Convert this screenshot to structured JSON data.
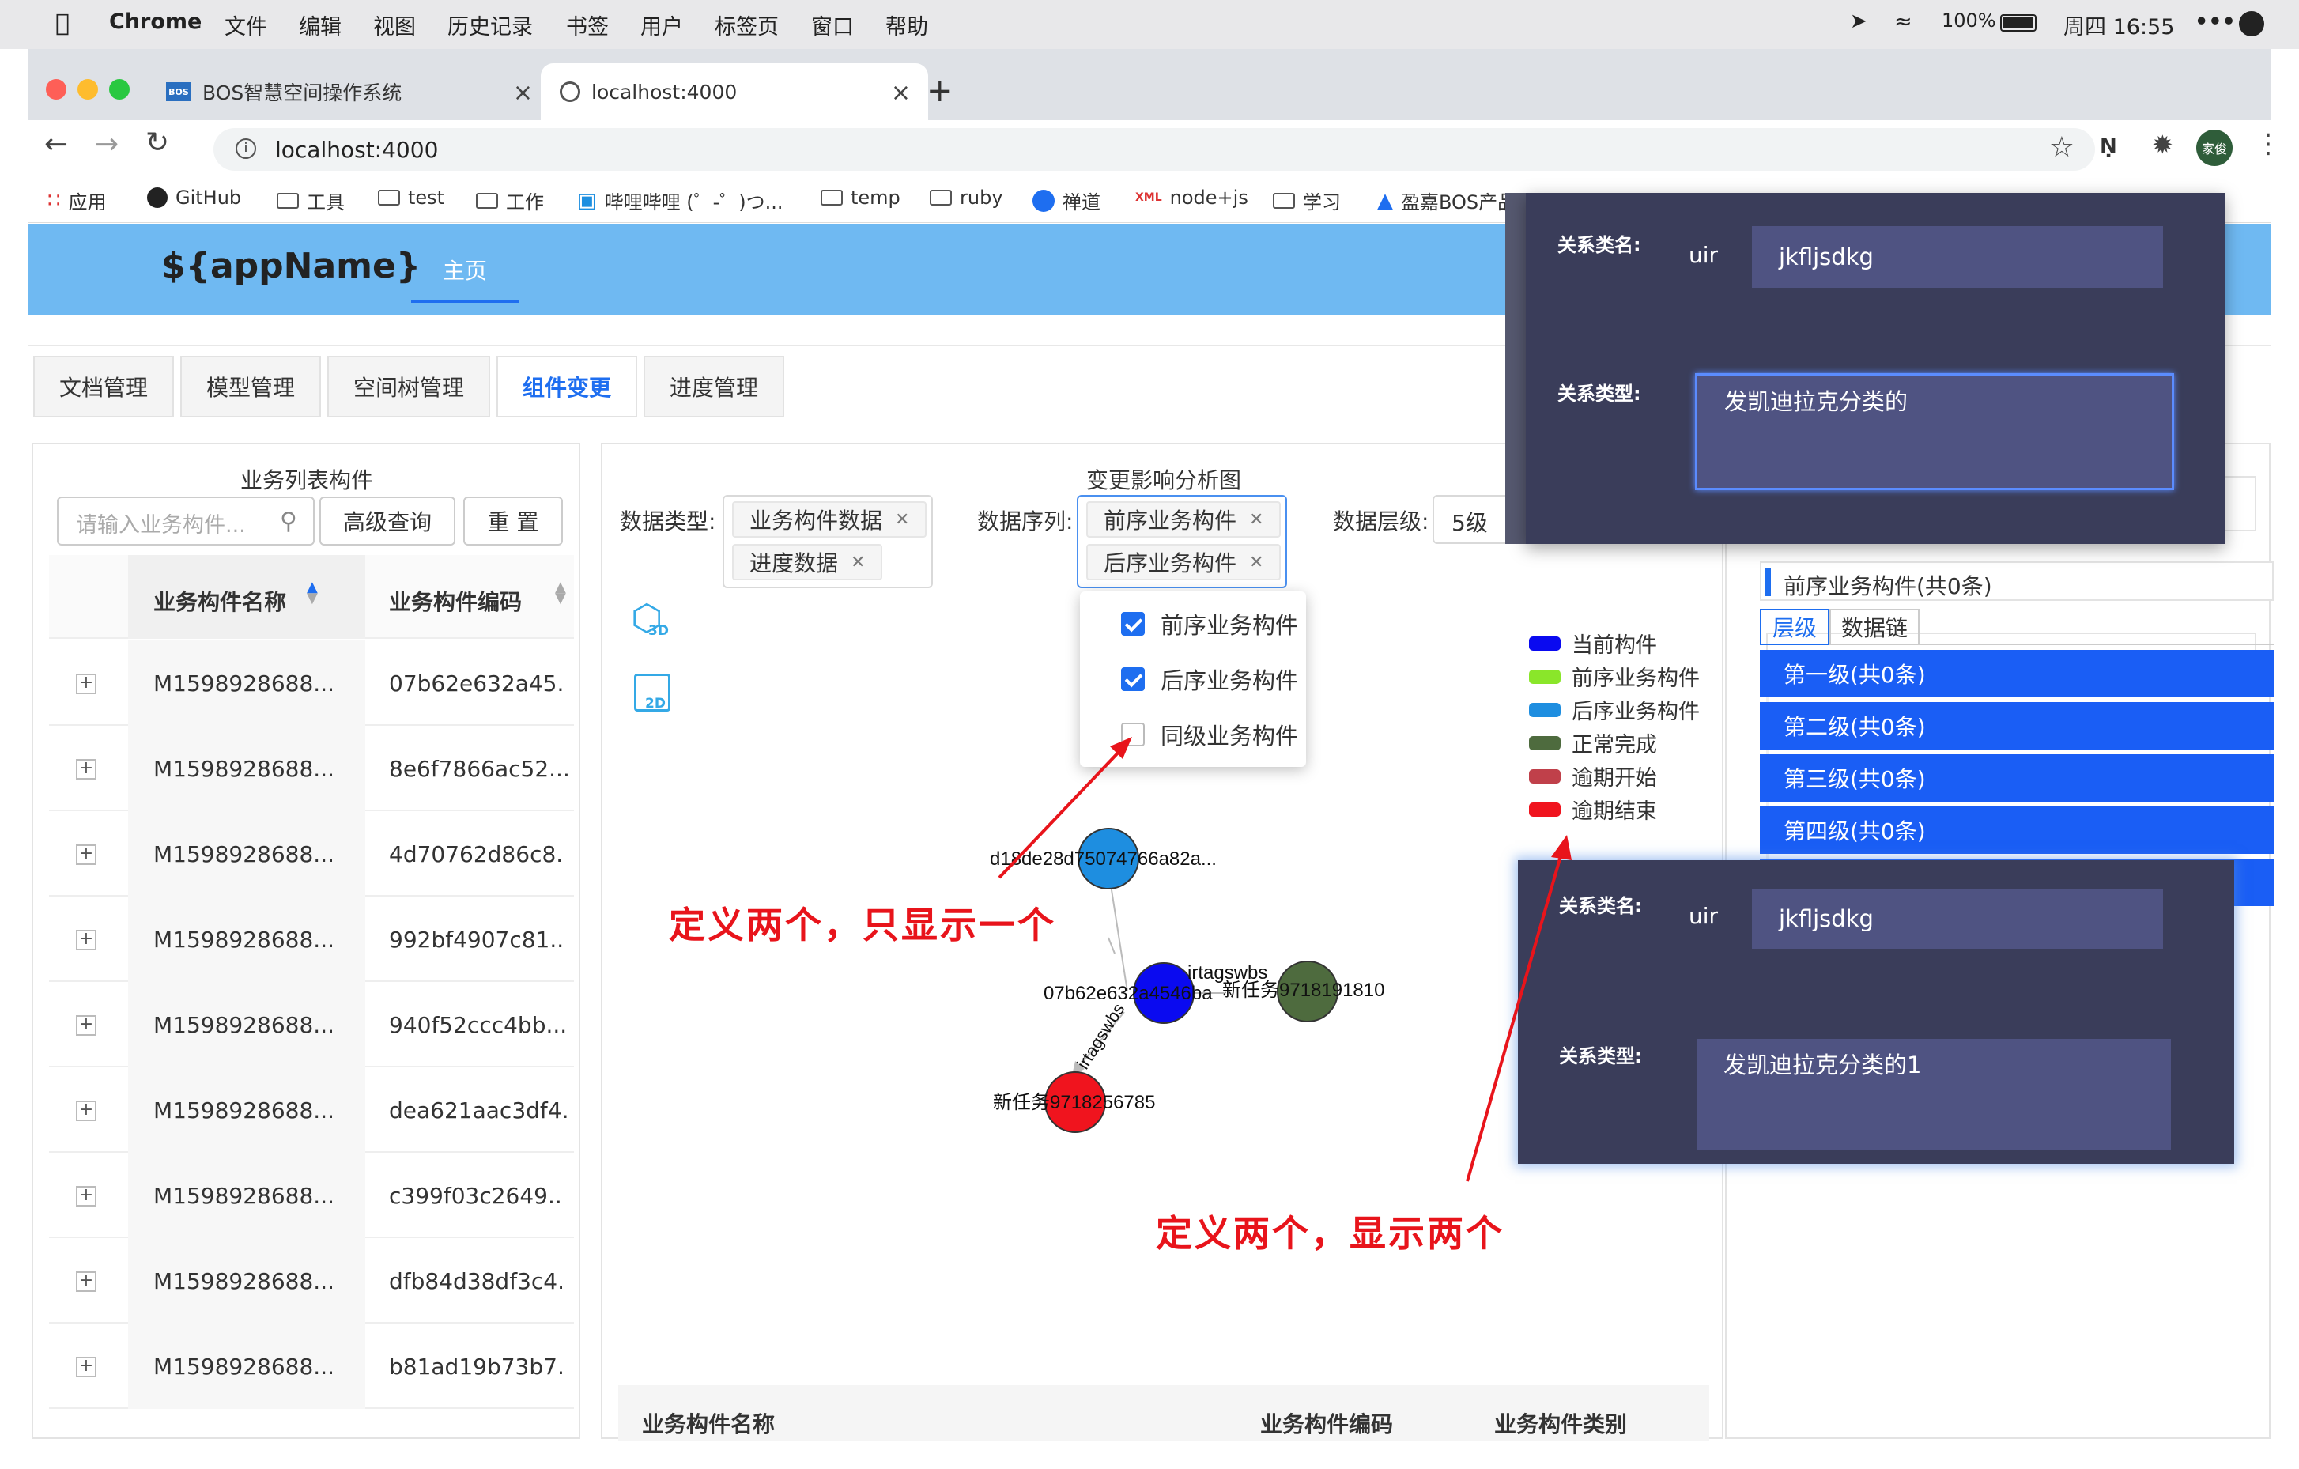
{
  "menubar": {
    "app": "Chrome",
    "items": [
      "文件",
      "编辑",
      "视图",
      "历史记录",
      "书签",
      "用户",
      "标签页",
      "窗口",
      "帮助"
    ],
    "battery": "100%",
    "clock": "周四 16:55"
  },
  "browser": {
    "tabs": [
      "BOS智慧空间操作系统",
      "localhost:4000"
    ],
    "url": "localhost:4000",
    "profile": "家俊"
  },
  "bookmarks": [
    "应用",
    "GitHub",
    "工具",
    "test",
    "工作",
    "哔哩哔哩 (゜-゜)つ...",
    "temp",
    "ruby",
    "禅道",
    "node+js",
    "学习",
    "盈嘉BOS产品"
  ],
  "app": {
    "title": "${appName}",
    "nav_home": "主页"
  },
  "tabs": [
    "文档管理",
    "模型管理",
    "空间树管理",
    "组件变更",
    "进度管理"
  ],
  "left": {
    "title": "业务列表构件",
    "search_placeholder": "请输入业务构件...",
    "advanced_btn": "高级查询",
    "reset_btn": "重 置",
    "columns": [
      "业务构件名称",
      "业务构件编码"
    ],
    "rows": [
      {
        "name": "M1598928688...",
        "code": "07b62e632a45."
      },
      {
        "name": "M1598928688...",
        "code": "8e6f7866ac52..."
      },
      {
        "name": "M1598928688...",
        "code": "4d70762d86c8."
      },
      {
        "name": "M1598928688...",
        "code": "992bf4907c81.."
      },
      {
        "name": "M1598928688...",
        "code": "940f52ccc4bb..."
      },
      {
        "name": "M1598928688...",
        "code": "dea621aac3df4."
      },
      {
        "name": "M1598928688...",
        "code": "c399f03c2649.."
      },
      {
        "name": "M1598928688...",
        "code": "dfb84d38df3c4."
      },
      {
        "name": "M1598928688...",
        "code": "b81ad19b73b7."
      }
    ]
  },
  "middle": {
    "title": "变更影响分析图",
    "data_type_label": "数据类型:",
    "data_type_tags": [
      "业务构件数据",
      "进度数据"
    ],
    "data_seq_label": "数据序列:",
    "data_seq_tags": [
      "前序业务构件",
      "后序业务构件"
    ],
    "data_level_label": "数据层级:",
    "data_level_value": "5级",
    "icon3d": "3D",
    "icon2d": "2D",
    "bottom_cols": [
      "业务构件名称",
      "业务构件编码",
      "业务构件类别"
    ]
  },
  "dropdown": [
    "前序业务构件",
    "后序业务构件",
    "同级业务构件"
  ],
  "graph": {
    "labels": [
      "d18de28d75074766a82a...",
      "07b62e632a4546ba",
      "irtagswbs",
      "新任务9718191810",
      "新任务9718256785",
      "irtagswbs"
    ]
  },
  "legend": [
    "当前构件",
    "前序业务构件",
    "后序业务构件",
    "正常完成",
    "逾期开始",
    "逾期结束"
  ],
  "legend_colors": [
    "#0a0af0",
    "#8ae62a",
    "#1e8ee0",
    "#4e6b3e",
    "#c0404a",
    "#f0141e"
  ],
  "right": {
    "section_title": "前序业务构件(共0条)",
    "tabs": [
      "层级",
      "数据链"
    ],
    "levels": [
      "第一级(共0条)",
      "第二级(共0条)",
      "第三级(共0条)",
      "第四级(共0条)"
    ]
  },
  "dialog1": {
    "name_label": "关系类名:",
    "prefix": "uir",
    "name_value": "jkfljsdkg",
    "type_label": "关系类型:",
    "type_value": "发凯迪拉克分类的"
  },
  "dialog2": {
    "name_label": "关系类名:",
    "prefix": "uir",
    "name_value": "jkfljsdkg",
    "type_label": "关系类型:",
    "type_value": "发凯迪拉克分类的1"
  },
  "annotations": [
    "定义两个，只显示一个",
    "定义两个，显示两个"
  ]
}
